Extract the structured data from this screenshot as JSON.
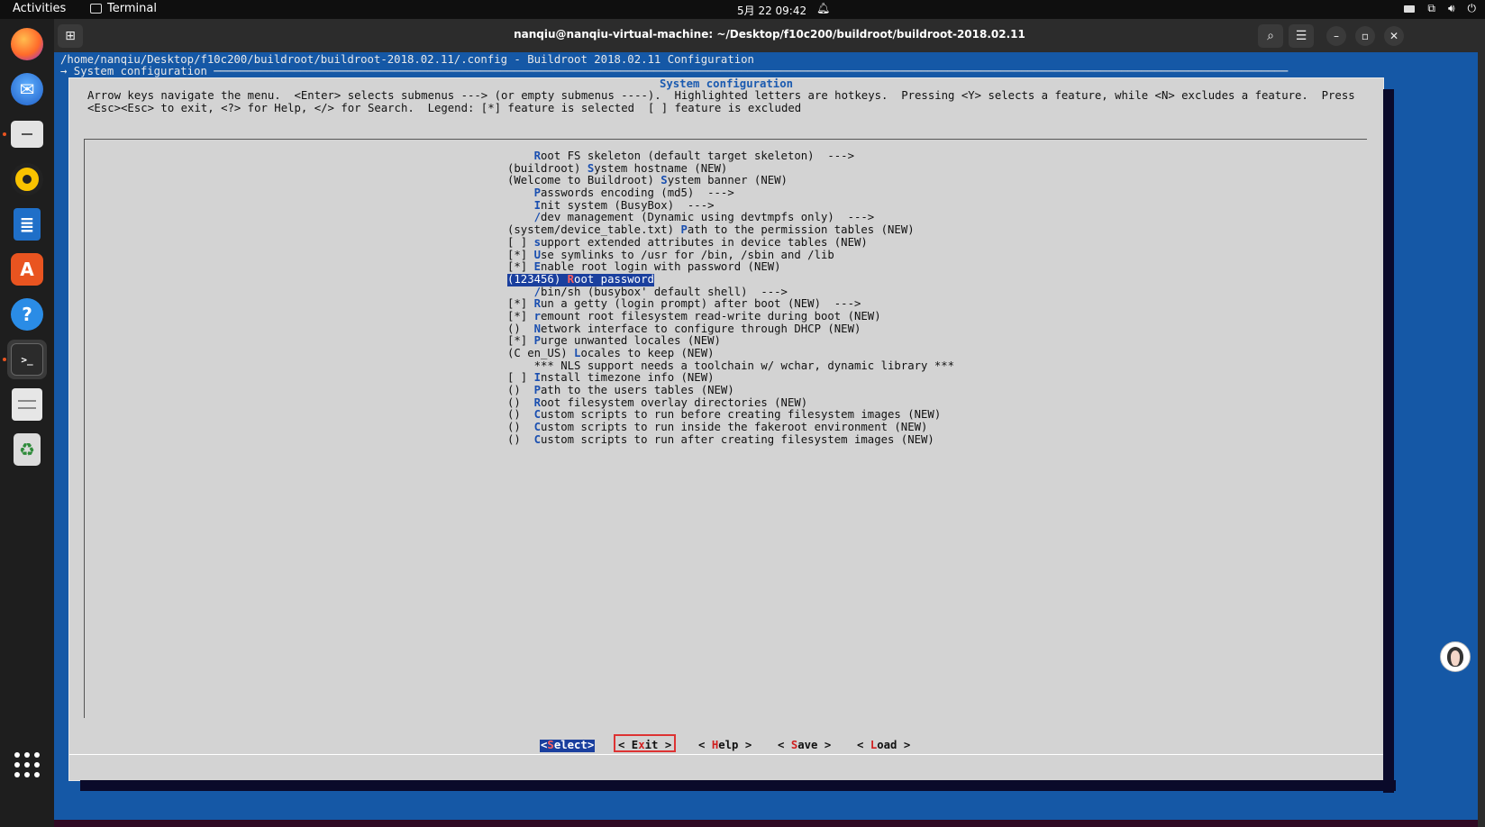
{
  "topbar": {
    "activities": "Activities",
    "app_name": "Terminal",
    "clock": "5月 22  09:42"
  },
  "dock": {
    "items": [
      "firefox-icon",
      "thunderbird-icon",
      "files-icon",
      "rhythmbox-icon",
      "writer-icon",
      "app-center-icon",
      "help-icon",
      "terminal-icon",
      "text-editor-icon",
      "trash-icon",
      "show-apps-icon"
    ]
  },
  "window": {
    "title": "nanqiu@nanqiu-virtual-machine: ~/Desktop/f10c200/buildroot/buildroot-2018.02.11"
  },
  "terminal": {
    "path_line": "/home/nanqiu/Desktop/f10c200/buildroot/buildroot-2018.02.11/.config - Buildroot 2018.02.11 Configuration",
    "breadcrumb": "→ System configuration ─────────────────────────────────────────────────────────────────────────────────────────────────────────────────────────────────────────────────────────────────",
    "dialog_title": "System configuration",
    "help_line_1": "Arrow keys navigate the menu.  <Enter> selects submenus ---> (or empty submenus ----).  Highlighted letters are hotkeys.  Pressing <Y> selects a feature, while <N> excludes a feature.  Press",
    "help_line_2": "<Esc><Esc> to exit, <?> for Help, </> for Search.  Legend: [*] feature is selected  [ ] feature is excluded",
    "menu_items": [
      {
        "pre": "    ",
        "hk": "R",
        "post": "oot FS skeleton (default target skeleton)  --->"
      },
      {
        "pre": "(buildroot) ",
        "hk": "S",
        "post": "ystem hostname (NEW)"
      },
      {
        "pre": "(Welcome to Buildroot) ",
        "hk": "S",
        "post": "ystem banner (NEW)"
      },
      {
        "pre": "    ",
        "hk": "P",
        "post": "asswords encoding (md5)  --->"
      },
      {
        "pre": "    ",
        "hk": "I",
        "post": "nit system (BusyBox)  --->"
      },
      {
        "pre": "    ",
        "hk": "/",
        "post": "dev management (Dynamic using devtmpfs only)  --->"
      },
      {
        "pre": "(system/device_table.txt) ",
        "hk": "P",
        "post": "ath to the permission tables (NEW)"
      },
      {
        "pre": "[ ] ",
        "hk": "s",
        "post": "upport extended attributes in device tables (NEW)"
      },
      {
        "pre": "[*] ",
        "hk": "U",
        "post": "se symlinks to /usr for /bin, /sbin and /lib"
      },
      {
        "pre": "[*] ",
        "hk": "E",
        "post": "nable root login with password (NEW)"
      },
      {
        "pre": "(123456) ",
        "hk": "R",
        "post": "oot password",
        "selected": true
      },
      {
        "pre": "    ",
        "hk": "/",
        "post": "bin/sh (busybox' default shell)  --->"
      },
      {
        "pre": "[*] ",
        "hk": "R",
        "post": "un a getty (login prompt) after boot (NEW)  --->"
      },
      {
        "pre": "[*] ",
        "hk": "r",
        "post": "emount root filesystem read-write during boot (NEW)"
      },
      {
        "pre": "()  ",
        "hk": "N",
        "post": "etwork interface to configure through DHCP (NEW)"
      },
      {
        "pre": "[*] ",
        "hk": "P",
        "post": "urge unwanted locales (NEW)"
      },
      {
        "pre": "(C en_US) ",
        "hk": "L",
        "post": "ocales to keep (NEW)"
      },
      {
        "pre": "    *** NLS support needs a toolchain w/ wchar, dynamic library ***",
        "hk": "",
        "post": ""
      },
      {
        "pre": "[ ] ",
        "hk": "I",
        "post": "nstall timezone info (NEW)"
      },
      {
        "pre": "()  ",
        "hk": "P",
        "post": "ath to the users tables (NEW)"
      },
      {
        "pre": "()  ",
        "hk": "R",
        "post": "oot filesystem overlay directories (NEW)"
      },
      {
        "pre": "()  ",
        "hk": "C",
        "post": "ustom scripts to run before creating filesystem images (NEW)"
      },
      {
        "pre": "()  ",
        "hk": "C",
        "post": "ustom scripts to run inside the fakeroot environment (NEW)"
      },
      {
        "pre": "()  ",
        "hk": "C",
        "post": "ustom scripts to run after creating filesystem images (NEW)"
      }
    ],
    "buttons": {
      "select": {
        "pre": "<",
        "hk": "S",
        "post": "elect>"
      },
      "exit": {
        "pre": "< E",
        "hk": "x",
        "post": "it >"
      },
      "help": {
        "pre": "< ",
        "hk": "H",
        "post": "elp >"
      },
      "save": {
        "pre": "< ",
        "hk": "S",
        "post": "ave >"
      },
      "load": {
        "pre": "< ",
        "hk": "L",
        "post": "oad >"
      }
    }
  },
  "colors": {
    "terminal_bg": "#1558a6",
    "dialog_bg": "#d3d3d3",
    "selection": "#1a3f9e",
    "hotkey": "#1a4fb0",
    "accent": "#e95420",
    "exit_highlight": "#dd3333"
  }
}
